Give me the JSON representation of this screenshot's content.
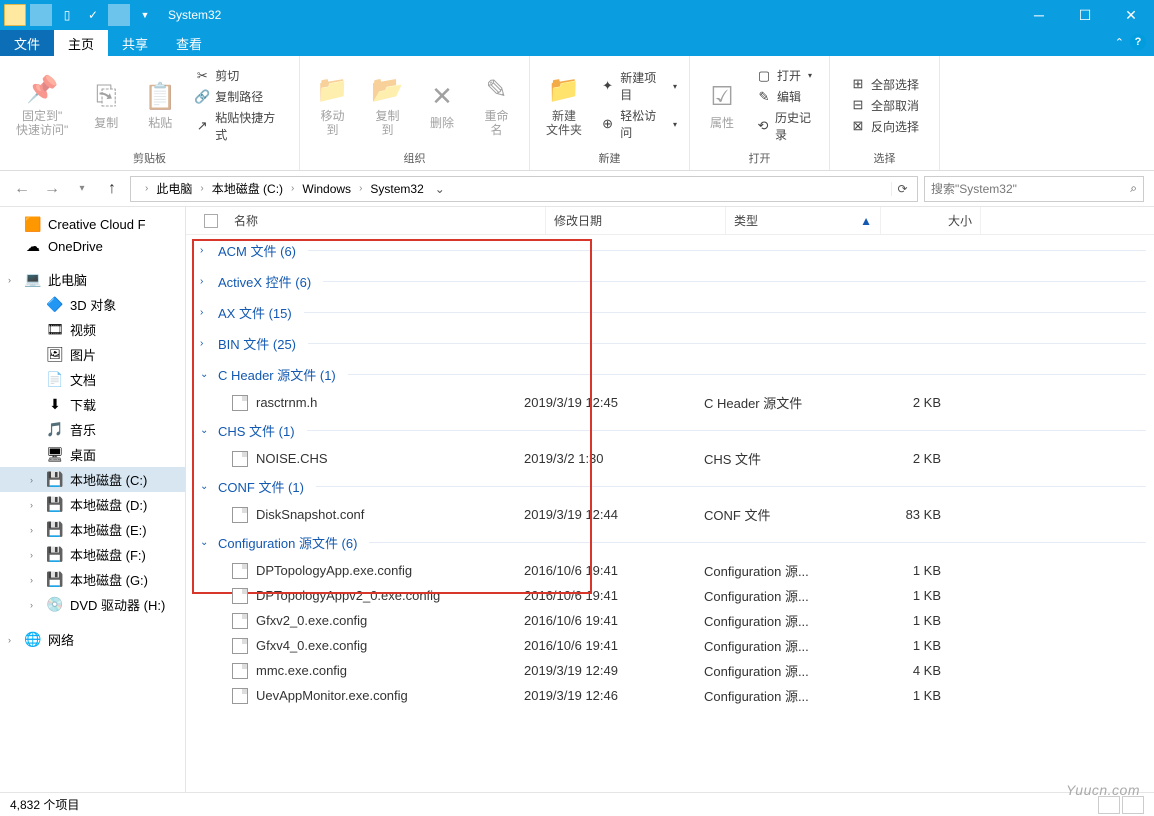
{
  "window": {
    "title": "System32"
  },
  "ribbon": {
    "file": "文件",
    "tabs": [
      "主页",
      "共享",
      "查看"
    ],
    "clipboard": {
      "label": "剪贴板",
      "pin": "固定到\"\n快速访问\"",
      "copy": "复制",
      "paste": "粘贴",
      "cut": "剪切",
      "copypath": "复制路径",
      "shortcut": "粘贴快捷方式"
    },
    "organize": {
      "label": "组织",
      "moveto": "移动到",
      "copyto": "复制到",
      "delete": "删除",
      "rename": "重命名"
    },
    "new": {
      "label": "新建",
      "folder": "新建\n文件夹",
      "item": "新建项目",
      "easy": "轻松访问"
    },
    "open": {
      "label": "打开",
      "props": "属性",
      "open": "打开",
      "edit": "编辑",
      "history": "历史记录"
    },
    "select": {
      "label": "选择",
      "all": "全部选择",
      "none": "全部取消",
      "invert": "反向选择"
    }
  },
  "breadcrumbs": [
    "此电脑",
    "本地磁盘 (C:)",
    "Windows",
    "System32"
  ],
  "search_placeholder": "搜索\"System32\"",
  "tree": {
    "items": [
      {
        "icon": "cc",
        "label": "Creative Cloud F",
        "indent": false
      },
      {
        "icon": "od",
        "label": "OneDrive",
        "indent": false
      },
      {
        "spacer": true
      },
      {
        "icon": "pc",
        "label": "此电脑",
        "indent": false,
        "chev": true
      },
      {
        "icon": "3d",
        "label": "3D 对象",
        "indent": true
      },
      {
        "icon": "vid",
        "label": "视频",
        "indent": true
      },
      {
        "icon": "pic",
        "label": "图片",
        "indent": true
      },
      {
        "icon": "doc",
        "label": "文档",
        "indent": true
      },
      {
        "icon": "dl",
        "label": "下载",
        "indent": true
      },
      {
        "icon": "mus",
        "label": "音乐",
        "indent": true
      },
      {
        "icon": "desk",
        "label": "桌面",
        "indent": true
      },
      {
        "icon": "hdd",
        "label": "本地磁盘 (C:)",
        "indent": true,
        "sel": true,
        "chev": true
      },
      {
        "icon": "hdd",
        "label": "本地磁盘 (D:)",
        "indent": true,
        "chev": true
      },
      {
        "icon": "hdd",
        "label": "本地磁盘 (E:)",
        "indent": true,
        "chev": true
      },
      {
        "icon": "hdd",
        "label": "本地磁盘 (F:)",
        "indent": true,
        "chev": true
      },
      {
        "icon": "hdd",
        "label": "本地磁盘 (G:)",
        "indent": true,
        "chev": true
      },
      {
        "icon": "dvd",
        "label": "DVD 驱动器 (H:)",
        "indent": true,
        "chev": true
      },
      {
        "spacer": true
      },
      {
        "icon": "net",
        "label": "网络",
        "indent": false,
        "chev": true
      }
    ]
  },
  "columns": {
    "name": "名称",
    "date": "修改日期",
    "type": "类型",
    "size": "大小"
  },
  "groups": [
    {
      "expanded": false,
      "label": "ACM 文件 (6)",
      "files": []
    },
    {
      "expanded": false,
      "label": "ActiveX 控件 (6)",
      "files": []
    },
    {
      "expanded": false,
      "label": "AX 文件 (15)",
      "files": []
    },
    {
      "expanded": false,
      "label": "BIN 文件 (25)",
      "files": []
    },
    {
      "expanded": true,
      "label": "C Header 源文件 (1)",
      "files": [
        {
          "name": "rasctrnm.h",
          "date": "2019/3/19 12:45",
          "type": "C Header 源文件",
          "size": "2 KB"
        }
      ]
    },
    {
      "expanded": true,
      "label": "CHS 文件 (1)",
      "files": [
        {
          "name": "NOISE.CHS",
          "date": "2019/3/2 1:30",
          "type": "CHS 文件",
          "size": "2 KB"
        }
      ]
    },
    {
      "expanded": true,
      "label": "CONF 文件 (1)",
      "files": [
        {
          "name": "DiskSnapshot.conf",
          "date": "2019/3/19 12:44",
          "type": "CONF 文件",
          "size": "83 KB"
        }
      ]
    },
    {
      "expanded": true,
      "label": "Configuration 源文件 (6)",
      "files": [
        {
          "name": "DPTopologyApp.exe.config",
          "date": "2016/10/6 19:41",
          "type": "Configuration 源...",
          "size": "1 KB"
        },
        {
          "name": "DPTopologyAppv2_0.exe.config",
          "date": "2016/10/6 19:41",
          "type": "Configuration 源...",
          "size": "1 KB"
        },
        {
          "name": "Gfxv2_0.exe.config",
          "date": "2016/10/6 19:41",
          "type": "Configuration 源...",
          "size": "1 KB"
        },
        {
          "name": "Gfxv4_0.exe.config",
          "date": "2016/10/6 19:41",
          "type": "Configuration 源...",
          "size": "1 KB"
        },
        {
          "name": "mmc.exe.config",
          "date": "2019/3/19 12:49",
          "type": "Configuration 源...",
          "size": "4 KB"
        },
        {
          "name": "UevAppMonitor.exe.config",
          "date": "2019/3/19 12:46",
          "type": "Configuration 源...",
          "size": "1 KB"
        }
      ]
    }
  ],
  "status": "4,832 个项目",
  "watermark": "Yuucn.com"
}
